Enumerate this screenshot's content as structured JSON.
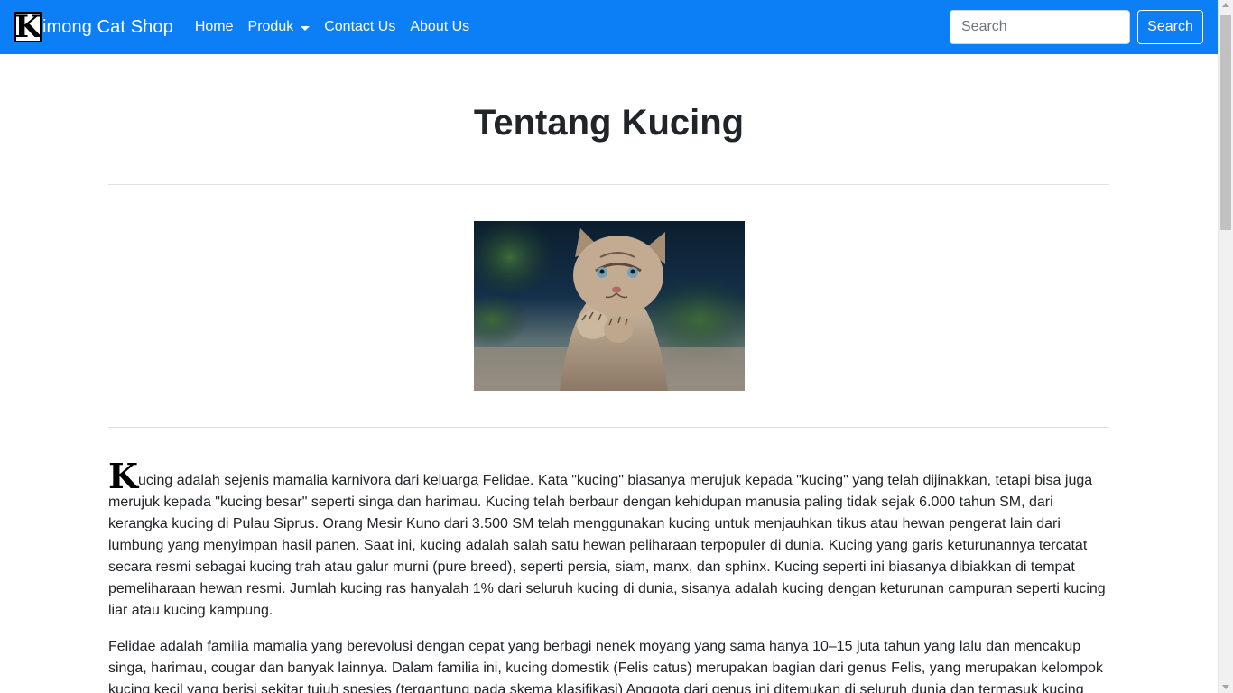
{
  "navbar": {
    "brand_logo": "K",
    "brand_text": "imong Cat Shop",
    "links": [
      {
        "label": "Home"
      },
      {
        "label": "Produk"
      },
      {
        "label": "Contact Us"
      },
      {
        "label": "About Us"
      }
    ],
    "search_placeholder": "Search",
    "search_button": "Search",
    "color": "#0d7ff6"
  },
  "icons": {
    "dropdown": "chevron-down-icon",
    "scrollbar": "scrollbar"
  },
  "main": {
    "title": "Tentang Kucing",
    "image_alt": "kitten",
    "dropcap": "K",
    "paragraph_1_rest": "ucing adalah sejenis mamalia karnivora dari keluarga Felidae. Kata \"kucing\" biasanya merujuk kepada \"kucing\" yang telah dijinakkan, tetapi bisa juga merujuk kepada \"kucing besar\" seperti singa dan harimau. Kucing telah berbaur dengan kehidupan manusia paling tidak sejak 6.000 tahun SM, dari kerangka kucing di Pulau Siprus. Orang Mesir Kuno dari 3.500 SM telah menggunakan kucing untuk menjauhkan tikus atau hewan pengerat lain dari lumbung yang menyimpan hasil panen. Saat ini, kucing adalah salah satu hewan peliharaan terpopuler di dunia. Kucing yang garis keturunannya tercatat secara resmi sebagai kucing trah atau galur murni (pure breed), seperti persia, siam, manx, dan sphinx. Kucing seperti ini biasanya dibiakkan di tempat pemeliharaan hewan resmi. Jumlah kucing ras hanyalah 1% dari seluruh kucing di dunia, sisanya adalah kucing dengan keturunan campuran seperti kucing liar atau kucing kampung.",
    "paragraph_2": "Felidae adalah familia mamalia yang berevolusi dengan cepat yang berbagi nenek moyang yang sama hanya 10–15 juta tahun yang lalu dan mencakup singa, harimau, cougar dan banyak lainnya. Dalam familia ini, kucing domestik (Felis catus) merupakan bagian dari genus Felis, yang merupakan kelompok kucing kecil yang berisi sekitar tujuh spesies (tergantung pada skema klasifikasi) Anggota dari genus ini ditemukan di seluruh dunia dan termasuk kucing"
  }
}
